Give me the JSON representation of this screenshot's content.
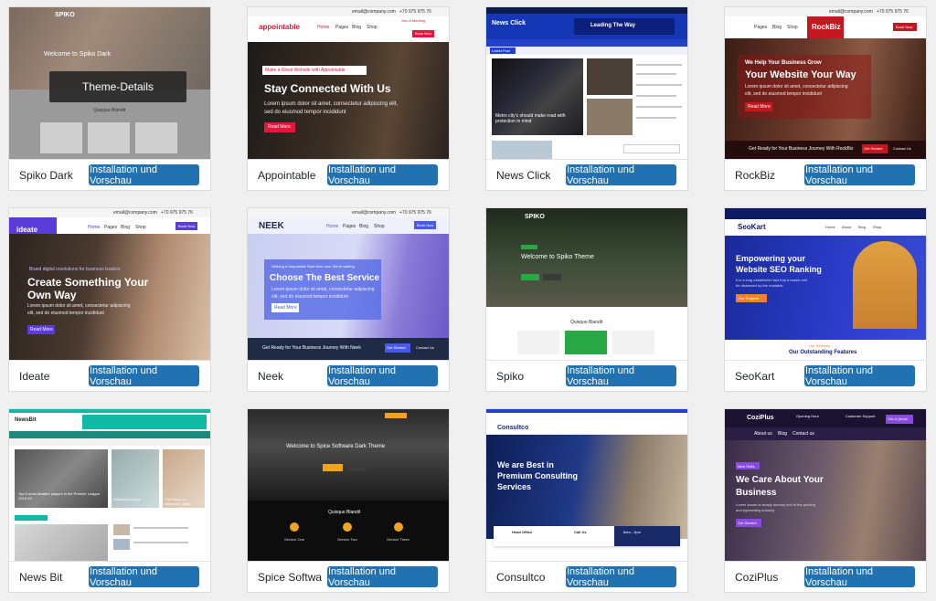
{
  "cards": [
    {
      "name": "Spiko Dark",
      "button": "Installation und Vorschau",
      "overlay": "Theme-Details",
      "shot": {
        "logo": "SPIKO",
        "hero": "Welcome to Spiko Dark",
        "sub": "Quisque Blandit"
      }
    },
    {
      "name": "Appointable",
      "button": "Installation und Vorschau",
      "shot": {
        "logo": "appointable",
        "email": "email@company.com",
        "phone": "+70 975 975 76",
        "cta": "Join A Meeting",
        "tag": "Make a Great Website with Appointable",
        "hero": "Stay Connected With Us",
        "body1": "Lorem ipsum dolor sit amet, consectetur adipiscing elit,",
        "body2": "sed do eiusmod tempor incididunt",
        "btn": "Read More",
        "nav": [
          "Home",
          "Pages",
          "Blog",
          "Shop"
        ],
        "book": "Book Now"
      }
    },
    {
      "name": "News Click",
      "button": "Installation und Vorschau",
      "shot": {
        "logo": "News Click",
        "banner": "Leading The Way",
        "headline": "Metro city's should make road with protection in mind",
        "trending": "Latest Post"
      }
    },
    {
      "name": "RockBiz",
      "button": "Installation und Vorschau",
      "shot": {
        "logo": "RockBiz",
        "email": "email@company.com",
        "phone": "+70 975 975 76",
        "tag": "We Help Your Business Grow",
        "hero": "Your Website Your Way",
        "body1": "Lorem ipsum dolor sit amet, consectetur adipiscing",
        "body2": "elit, sed do eiusmod tempor incididunt",
        "btn": "Read More",
        "cta": "Get Ready for Your Business Journey With RockBiz",
        "cta_btn1": "Get Started",
        "cta_btn2": "Contact Us",
        "nav": [
          "Pages",
          "Blog",
          "Shop"
        ],
        "book": "Book Now"
      }
    },
    {
      "name": "Ideate",
      "button": "Installation und Vorschau",
      "shot": {
        "logo": "ideate",
        "email": "email@company.com",
        "phone": "+70 975 975 76",
        "tag": "Brand digital resolutions for business leaders",
        "hero1": "Create Something Your",
        "hero2": "Own Way",
        "body1": "Lorem ipsum dolor sit amet, consectetur adipiscing",
        "body2": "elit, sed do eiusmod tempor incididunt",
        "btn": "Read More",
        "nav": [
          "Home",
          "Pages",
          "Blog",
          "Shop"
        ],
        "book": "Book Now"
      }
    },
    {
      "name": "Neek",
      "button": "Installation und Vorschau",
      "shot": {
        "logo": "NEEK",
        "email": "email@company.com",
        "phone": "+70 975 975 76",
        "tag": "Nothing is impossible Start from now. We're waiting",
        "hero": "Choose The Best Service",
        "body1": "Lorem ipsum dolor sit amet, consectetur adipiscing",
        "body2": "elit, sed do eiusmod tempor incididunt",
        "btn": "Read More",
        "cta": "Get Ready for Your Business Journey With Neek",
        "cta_btn1": "Get Started",
        "cta_btn2": "Contact Us",
        "nav": [
          "Home",
          "Pages",
          "Blog",
          "Shop"
        ],
        "book": "Book Now"
      }
    },
    {
      "name": "Spiko",
      "button": "Installation und Vorschau",
      "shot": {
        "logo": "SPIKO",
        "hero": "Welcome to Spiko Theme",
        "sub": "Quisque Blandit"
      }
    },
    {
      "name": "SeoKart",
      "button": "Installation und Vorschau",
      "shot": {
        "logo": "SeoKart",
        "hero1": "Empowering your",
        "hero2": "Website SEO Ranking",
        "body1": "It is a long established fact that a reader will",
        "body2": "be distracted by the readable",
        "btn": "Our Projects",
        "tag": "Our Services",
        "footer": "Our Outstanding Features",
        "nav": [
          "Home",
          "About",
          "Blog",
          "Shop"
        ]
      }
    },
    {
      "name": "News Bit",
      "button": "Installation und Vorschau",
      "shot": {
        "logo": "NewsBit",
        "headline1": "Top 5 most Awaited players in the Premier League 2019-20",
        "headline2": "Warned to Know",
        "headline3": "The future of Nintendo's New"
      }
    },
    {
      "name": "Spice Softwa",
      "button": "Installation und Vorschau",
      "shot": {
        "hero": "Welcome to Spice Software Dark Theme",
        "sub": "Quisque Blandit",
        "btn": "Read More",
        "features": [
          "Service One",
          "Service Two",
          "Service Three"
        ]
      }
    },
    {
      "name": "Consultco",
      "button": "Installation und Vorschau",
      "shot": {
        "logo": "Consultco",
        "hero1": "We are Best in",
        "hero2": "Premium Consulting",
        "hero3": "Services",
        "info1": "Head Office",
        "info2": "Call Us",
        "info3": "8am - 9pm"
      }
    },
    {
      "name": "CoziPlus",
      "button": "Installation und Vorschau",
      "shot": {
        "logo": "CoziPlus",
        "hours": "Opening Hour",
        "support": "Customer Support",
        "tag": "New Skills",
        "hero1": "We Care About Your",
        "hero2": "Business",
        "body1": "Lorem Ipsum is simply dummy text of the printing",
        "body2": "and typesetting industry",
        "btn": "Get Started",
        "nav": [
          "About us",
          "Blog",
          "Contact us"
        ],
        "quote": "Get A Quote"
      }
    }
  ],
  "colors": {
    "button": "#2271b1",
    "accent_red": "#e2173b",
    "accent_purple": "#5a3dd8",
    "accent_blue": "#2340c9",
    "accent_teal": "#12b8a5",
    "accent_green": "#27a844",
    "accent_orange": "#f2a21b"
  }
}
